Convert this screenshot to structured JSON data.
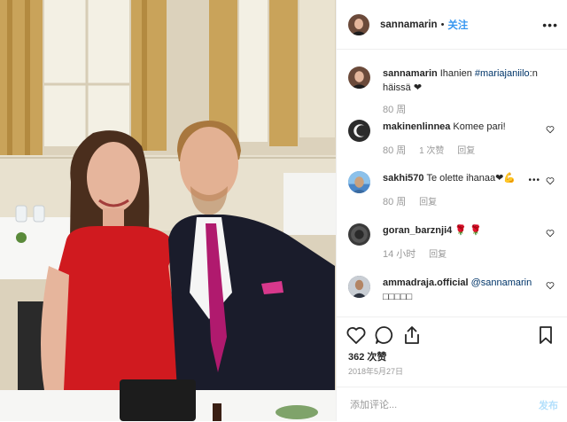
{
  "post": {
    "author": "sannamarin",
    "dot": "•",
    "follow_label": "关注",
    "more_label": "•••",
    "photo_description": "couple-at-event-photo"
  },
  "caption": {
    "username": "sannamarin",
    "text_before": "Ihanien ",
    "hashtag": "#mariajaniilo",
    "text_after": ":n häissä ❤",
    "time": "80 周"
  },
  "comments": [
    {
      "username": "makinenlinnea",
      "text": "Komee pari!",
      "time": "80 周",
      "likes": "1 次赞",
      "reply": "回复",
      "avatar_color": "#2b2b2b"
    },
    {
      "username": "sakhi570",
      "text": "Te olette ihanaa❤💪",
      "time": "80 周",
      "reply": "回复",
      "avatar_color": "#4a86c7"
    },
    {
      "username": "goran_barznji4",
      "text": "🌹 🌹",
      "time": "14 小时",
      "reply": "回复",
      "avatar_color": "#3a3a3a"
    },
    {
      "username": "ammadraja.official",
      "mention": "@sannamarin",
      "text": "□□□□□",
      "avatar_color": "#556070"
    }
  ],
  "actions": {
    "likes": "362 次赞",
    "date": "2018年5月27日",
    "comment_placeholder": "添加评论...",
    "post_label": "发布"
  },
  "colors": {
    "accent": "#3897f0",
    "hashtag": "#003569",
    "muted": "#999999",
    "post_disabled": "#b2dffc"
  }
}
